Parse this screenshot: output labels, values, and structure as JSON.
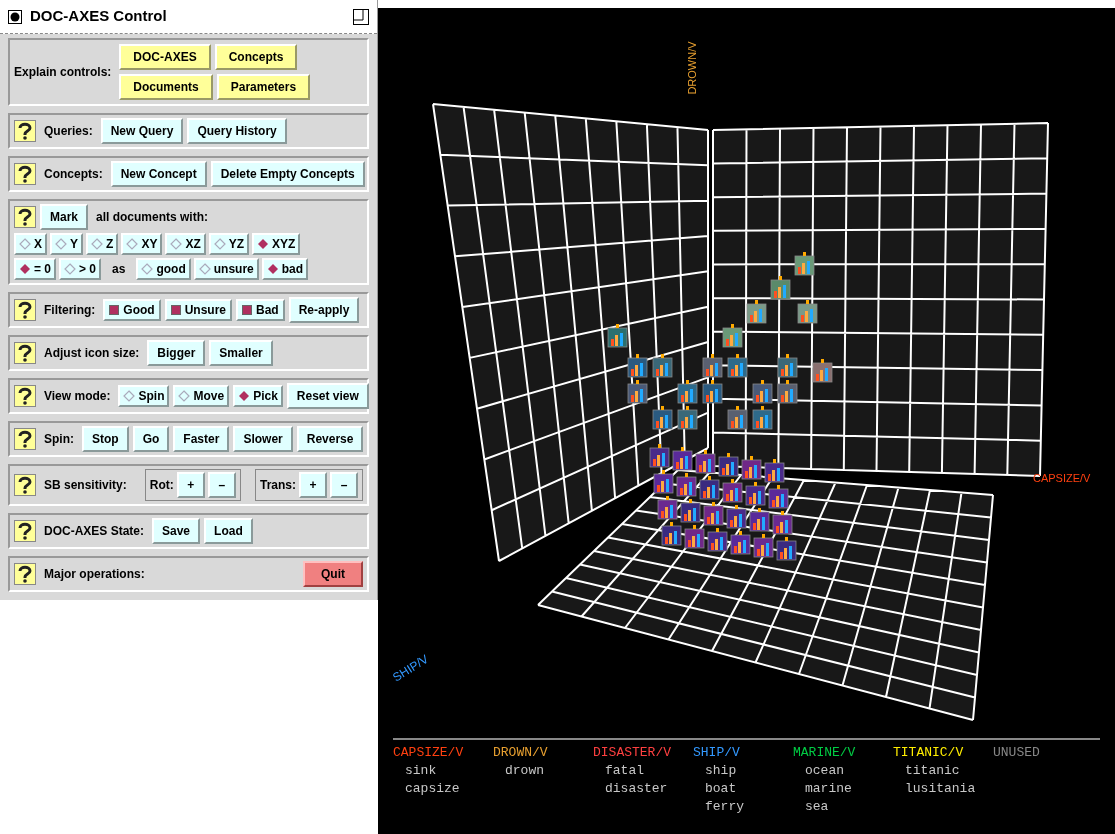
{
  "window": {
    "title": "DOC-AXES Control"
  },
  "explain": {
    "label": "Explain controls:",
    "buttons": [
      "DOC-AXES",
      "Concepts",
      "Documents",
      "Parameters"
    ]
  },
  "sections": [
    {
      "kind": "row",
      "items": [
        {
          "kind": "label",
          "text": "Queries:"
        },
        {
          "kind": "button",
          "text": "New Query"
        },
        {
          "kind": "button",
          "text": "Query History"
        }
      ]
    },
    {
      "kind": "row",
      "items": [
        {
          "kind": "label",
          "text": "Concepts:"
        },
        {
          "kind": "button",
          "text": "New Concept"
        },
        {
          "kind": "button",
          "text": "Delete Empty Concepts"
        }
      ]
    },
    {
      "kind": "mark",
      "button": "Mark",
      "label": "all documents with:",
      "as_label": "as",
      "scope": [
        {
          "text": "X",
          "selected": false
        },
        {
          "text": "Y",
          "selected": false
        },
        {
          "text": "Z",
          "selected": false
        },
        {
          "text": "XY",
          "selected": false
        },
        {
          "text": "XZ",
          "selected": false
        },
        {
          "text": "YZ",
          "selected": false
        },
        {
          "text": "XYZ",
          "selected": true
        }
      ],
      "count": [
        {
          "text": "= 0",
          "selected": true
        },
        {
          "text": "> 0",
          "selected": false
        }
      ],
      "grade": [
        {
          "text": "good",
          "selected": false
        },
        {
          "text": "unsure",
          "selected": false
        },
        {
          "text": "bad",
          "selected": true
        }
      ]
    },
    {
      "kind": "row",
      "items": [
        {
          "kind": "label",
          "text": "Filtering:"
        },
        {
          "kind": "checkbox",
          "text": "Good",
          "checked": true
        },
        {
          "kind": "checkbox",
          "text": "Unsure",
          "checked": true
        },
        {
          "kind": "checkbox",
          "text": "Bad",
          "checked": true
        },
        {
          "kind": "button",
          "text": "Re-apply"
        }
      ]
    },
    {
      "kind": "row",
      "items": [
        {
          "kind": "label",
          "text": "Adjust icon size:"
        },
        {
          "kind": "button",
          "text": "Bigger"
        },
        {
          "kind": "button",
          "text": "Smaller"
        }
      ]
    },
    {
      "kind": "row",
      "items": [
        {
          "kind": "label",
          "text": "View mode:"
        },
        {
          "kind": "radio",
          "text": "Spin",
          "selected": false
        },
        {
          "kind": "radio",
          "text": "Move",
          "selected": false
        },
        {
          "kind": "radio",
          "text": "Pick",
          "selected": true
        },
        {
          "kind": "button",
          "text": "Reset view"
        }
      ]
    },
    {
      "kind": "row",
      "items": [
        {
          "kind": "label",
          "text": "Spin:"
        },
        {
          "kind": "button",
          "text": "Stop"
        },
        {
          "kind": "button",
          "text": "Go"
        },
        {
          "kind": "button",
          "text": "Faster"
        },
        {
          "kind": "button",
          "text": "Slower"
        },
        {
          "kind": "button",
          "text": "Reverse"
        }
      ]
    },
    {
      "kind": "row",
      "items": [
        {
          "kind": "label",
          "text": "SB sensitivity:"
        },
        {
          "kind": "group",
          "label": "Rot:",
          "buttons": [
            "+",
            "–"
          ]
        },
        {
          "kind": "group",
          "label": "Trans:",
          "buttons": [
            "+",
            "–"
          ]
        }
      ]
    },
    {
      "kind": "row",
      "items": [
        {
          "kind": "label",
          "text": "DOC-AXES State:"
        },
        {
          "kind": "button",
          "text": "Save"
        },
        {
          "kind": "button",
          "text": "Load"
        }
      ]
    },
    {
      "kind": "row",
      "items": [
        {
          "kind": "label",
          "text": "Major operations:"
        },
        {
          "kind": "danger",
          "text": "Quit"
        }
      ]
    }
  ],
  "scene": {
    "axis_labels": [
      {
        "kind": "vertical",
        "text": "DROWN/V",
        "color": "#e8a030"
      },
      {
        "kind": "right",
        "text": "CAPSIZE/V",
        "color": "#ff4010"
      },
      {
        "kind": "slanted",
        "text": "SHIP/V",
        "color": "#3399ff"
      }
    ]
  },
  "legend": [
    {
      "name": "CAPSIZE/V",
      "color": "#ff4010",
      "terms": [
        "sink",
        "capsize"
      ]
    },
    {
      "name": "DROWN/V",
      "color": "#e8a030",
      "terms": [
        "drown"
      ]
    },
    {
      "name": "DISASTER/V",
      "color": "#ff4040",
      "terms": [
        "fatal",
        "disaster"
      ]
    },
    {
      "name": "SHIP/V",
      "color": "#3399ff",
      "terms": [
        "ship",
        "boat",
        "ferry"
      ]
    },
    {
      "name": "MARINE/V",
      "color": "#00cc44",
      "terms": [
        "ocean",
        "marine",
        "sea"
      ]
    },
    {
      "name": "TITANIC/V",
      "color": "#ffee00",
      "terms": [
        "titanic",
        "lusitania"
      ]
    },
    {
      "name": "UNUSED",
      "color": "#888888"
    }
  ]
}
